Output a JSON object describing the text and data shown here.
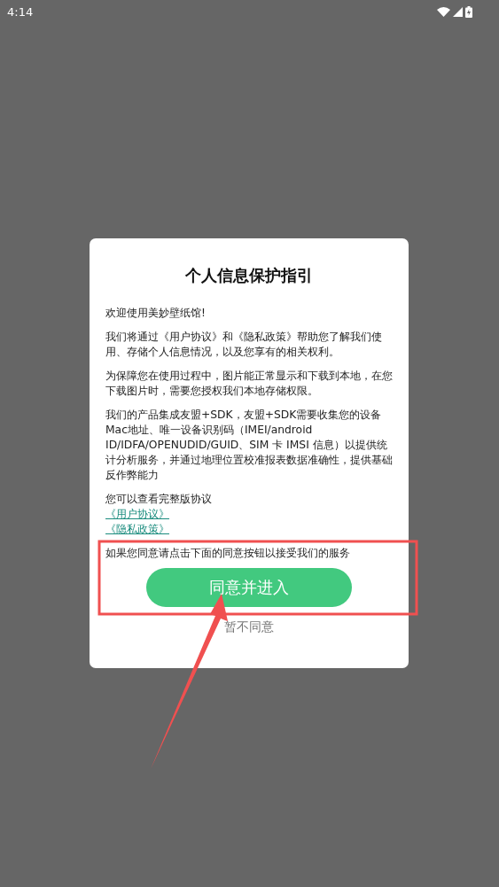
{
  "status_bar": {
    "time": "4:14"
  },
  "dialog": {
    "title": "个人信息保护指引",
    "paragraphs": [
      "欢迎使用美妙壁纸馆!",
      "我们将通过《用户协议》和《隐私政策》帮助您了解我们使用、存储个人信息情况，以及您享有的相关权利。",
      "为保障您在使用过程中，图片能正常显示和下载到本地，在您下载图片时，需要您授权我们本地存储权限。",
      "我们的产品集成友盟+SDK，友盟+SDK需要收集您的设备Mac地址、唯一设备识别码（IMEI/android ID/IDFA/OPENUDID/GUID、SIM 卡 IMSI 信息）以提供统计分析服务，并通过地理位置校准报表数据准确性，提供基础反作弊能力"
    ],
    "links_intro": "您可以查看完整版协议",
    "links": [
      "《用户协议》",
      "《隐私政策》"
    ],
    "closing": "如果您同意请点击下面的同意按钮以接受我们的服务",
    "accept_button": "同意并进入",
    "decline_button": "暂不同意"
  },
  "annotations": {
    "highlight_box": {
      "color": "#f05050"
    },
    "arrow": {
      "color": "#f05050"
    }
  }
}
